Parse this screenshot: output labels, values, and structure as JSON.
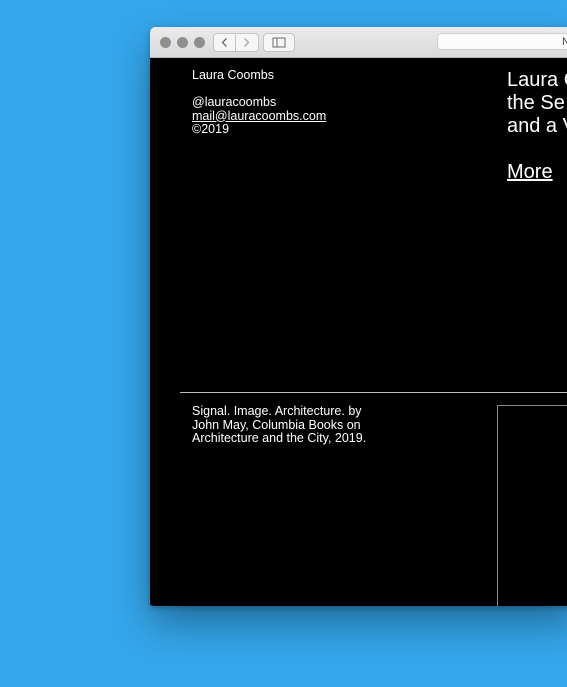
{
  "browser": {
    "url_text": "N"
  },
  "sidebar": {
    "name": "Laura Coombs",
    "handle": "@lauracoombs",
    "email": "mail@lauracoombs.com",
    "copyright": "©2019"
  },
  "intro": {
    "lines": [
      "Laura C",
      "the Se",
      "and a V"
    ],
    "more_label": "More"
  },
  "project": {
    "caption_lines": [
      "Signal. Image. Architecture. by",
      "John May, Columbia Books on",
      "Architecture and the City, 2019."
    ]
  }
}
